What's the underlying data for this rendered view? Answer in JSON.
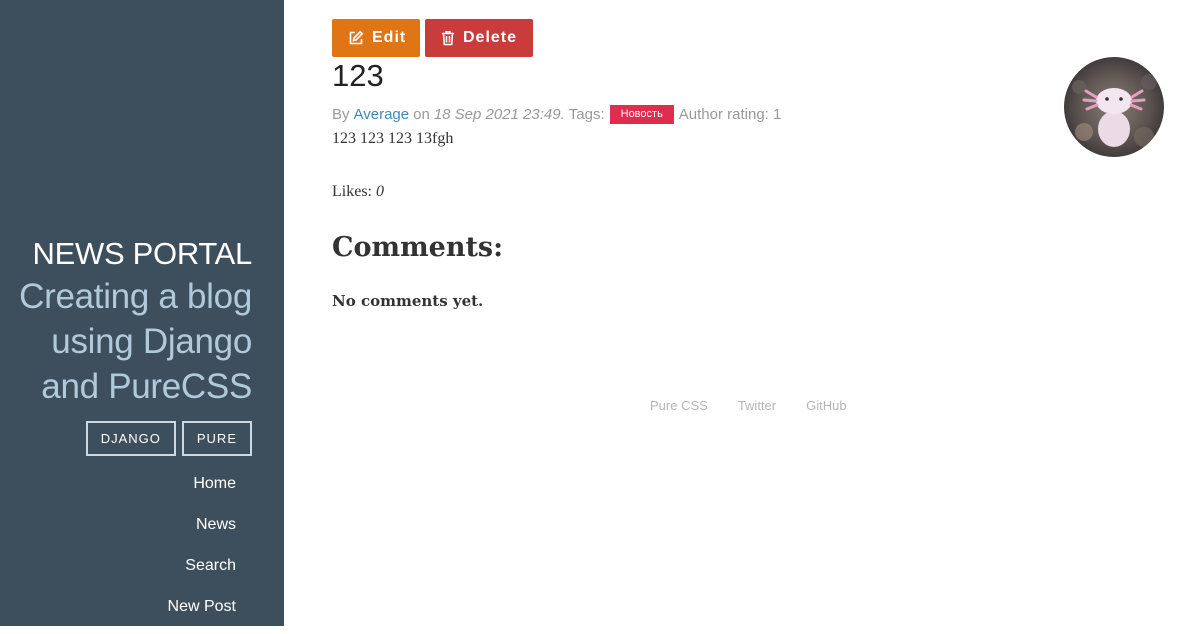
{
  "sidebar": {
    "title": "NEWS PORTAL",
    "tagline": "Creating a blog using Django and PureCSS",
    "tag_buttons": [
      "DJANGO",
      "PURE"
    ],
    "nav": [
      "Home",
      "News",
      "Search",
      "New Post"
    ]
  },
  "post": {
    "actions": {
      "edit_label": "Edit",
      "delete_label": "Delete"
    },
    "title": "123",
    "meta": {
      "by_label": "By",
      "author": "Average",
      "on_label": "on",
      "date": "18 Sep 2021 23:49.",
      "tags_label": "Tags:",
      "tag": "Новость",
      "rating_label": "Author rating: 1"
    },
    "body": "123 123 123 13fgh",
    "likes_label": "Likes:",
    "likes_count": "0"
  },
  "comments": {
    "title": "Comments:",
    "empty_text": "No comments yet."
  },
  "footer": {
    "links": [
      "Pure CSS",
      "Twitter",
      "GitHub"
    ]
  },
  "colors": {
    "sidebar_bg": "#3d4f5d",
    "edit_button": "#df7514",
    "delete_button": "#ca3c3c",
    "tag_pill": "#df2d4f",
    "link": "#3b8bba"
  }
}
